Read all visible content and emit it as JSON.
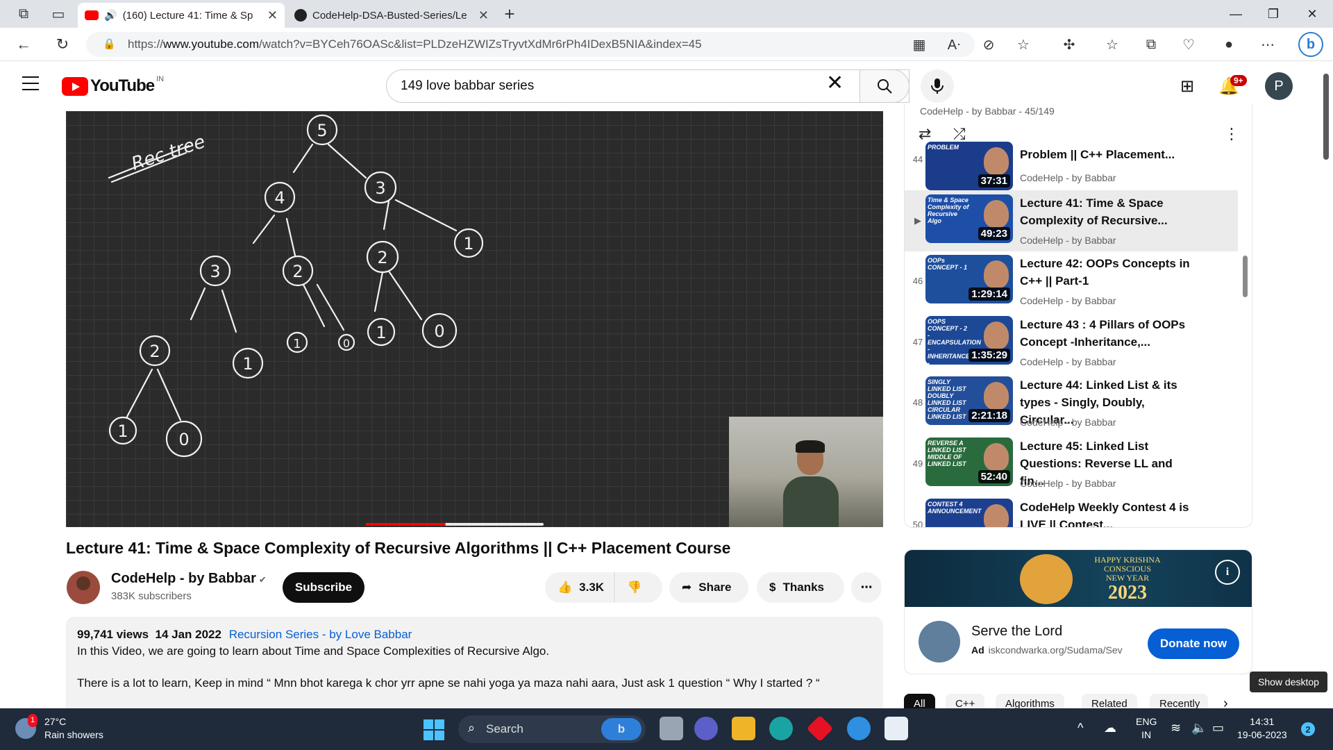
{
  "browser": {
    "tabs": [
      {
        "label": "(160) Lecture 41: Time & Sp",
        "active": true
      },
      {
        "label": "CodeHelp-DSA-Busted-Series/Le",
        "active": false
      }
    ],
    "url_prefix": "https://",
    "url_host": "www.youtube.com",
    "url_path": "/watch?v=BYCeh76OASc&list=PLDzeHZWIZsTryvtXdMr6rPh4IDexB5NIA&index=45"
  },
  "youtube": {
    "logo_text": "YouTube",
    "country_code": "IN",
    "search_value": "149 love babbar series",
    "notif_badge": "9+",
    "avatar_letter": "P"
  },
  "video": {
    "title": "Lecture 41: Time & Space Complexity of Recursive Algorithms || C++ Placement Course",
    "whiteboard_label": "Rec tree",
    "tree_nodes": [
      "5",
      "4",
      "3",
      "3",
      "2",
      "2",
      "1",
      "2",
      "1",
      "1",
      "0",
      "1",
      "0",
      "1",
      "0"
    ],
    "progress_fraction": 0.45
  },
  "channel": {
    "name": "CodeHelp - by Babbar",
    "verified": "✔",
    "subscribers": "383K subscribers",
    "subscribe_label": "Subscribe"
  },
  "actions": {
    "likes": "3.3K",
    "share_label": "Share",
    "thanks_label": "Thanks",
    "more": "⋯"
  },
  "description": {
    "views": "99,741 views",
    "date": "14 Jan 2022",
    "playlist_link": "Recursion Series - by Love Babbar",
    "line1": "In this Video, we are going to learn about Time and Space Complexities of Recursive Algo.",
    "line2": "There is a lot to learn, Keep in mind “ Mnn bhot karega k chor yrr apne se nahi yoga ya maza nahi aara, Just ask 1 question “ Why I started ? “"
  },
  "playlist": {
    "header": "CodeHelp - by Babbar - 45/149",
    "items": [
      {
        "num": "44",
        "title": "Problem || C++ Placement...",
        "channel": "CodeHelp - by Babbar",
        "duration": "37:31",
        "thumb_text": "PROBLEM",
        "thumb_color": "#1b3c8a"
      },
      {
        "num": "▶",
        "title": "Lecture 41: Time & Space Complexity of Recursive...",
        "channel": "CodeHelp - by Babbar",
        "duration": "49:23",
        "thumb_text": "Time & Space Complexity of Recursive Algo",
        "thumb_color": "#1d4fa8",
        "active": true
      },
      {
        "num": "46",
        "title": "Lecture 42: OOPs Concepts in C++ || Part-1",
        "channel": "CodeHelp - by Babbar",
        "duration": "1:29:14",
        "thumb_text": "OOPs CONCEPT - 1",
        "thumb_color": "#1e4f9c"
      },
      {
        "num": "47",
        "title": "Lecture 43 : 4 Pillars of OOPs Concept -Inheritance,...",
        "channel": "CodeHelp - by Babbar",
        "duration": "1:35:29",
        "thumb_text": "OOPS CONCEPT - 2 -ENCAPSULATION -INHERITANCE -POLYMORPHISM -ABSTRACTION",
        "thumb_color": "#1c4896"
      },
      {
        "num": "48",
        "title": "Lecture 44: Linked List & its types - Singly, Doubly, Circular...",
        "channel": "CodeHelp - by Babbar",
        "duration": "2:21:18",
        "thumb_text": "SINGLY LINKED LIST DOUBLY LINKED LIST CIRCULAR LINKED LIST",
        "thumb_color": "#234f9a"
      },
      {
        "num": "49",
        "title": "Lecture 45: Linked List Questions: Reverse LL and fin...",
        "channel": "CodeHelp - by Babbar",
        "duration": "52:40",
        "thumb_text": "REVERSE A LINKED LIST MIDDLE OF LINKED LIST",
        "thumb_color": "#2a6b3d"
      },
      {
        "num": "50",
        "title": "CodeHelp Weekly Contest 4 is LIVE || Contest...",
        "channel": "",
        "duration": "",
        "thumb_text": "CONTEST 4 ANNOUNCEMENT",
        "thumb_color": "#1c3f8f"
      }
    ]
  },
  "ad": {
    "banner_line1": "HAPPY KRISHNA",
    "banner_line2": "CONSCIOUS",
    "banner_line3": "NEW YEAR",
    "banner_year": "2023",
    "title": "Serve the Lord",
    "ad_label": "Ad",
    "domain": "iskcondwarka.org/Sudama/Sev",
    "cta": "Donate now",
    "info_icon": "i"
  },
  "chips": [
    "All",
    "C++",
    "Algorithms",
    "Related",
    "Recently"
  ],
  "tooltip": "Show desktop",
  "taskbar": {
    "temp": "27°C",
    "weather": "Rain showers",
    "weather_badge": "1",
    "search_placeholder": "Search",
    "lang1": "ENG",
    "lang2": "IN",
    "time": "14:31",
    "date": "19-06-2023",
    "notif_count": "2"
  },
  "colors": {
    "yt_red": "#ff0000",
    "link_blue": "#065fd4",
    "taskbar_bg": "#1f2a3a"
  }
}
